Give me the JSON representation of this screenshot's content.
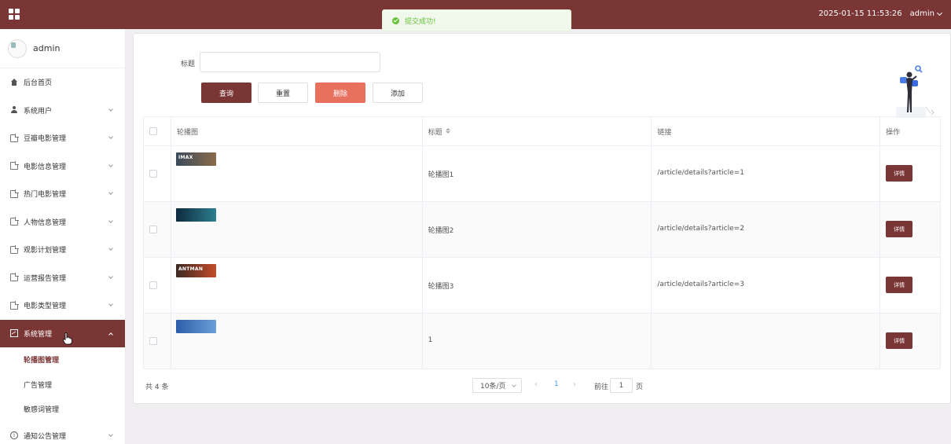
{
  "header": {
    "datetime": "2025-01-15 11:53:26",
    "user": "admin",
    "bar_color": "#7a3535"
  },
  "toast": {
    "message": "提交成功!",
    "type": "success"
  },
  "sidebar": {
    "user_name": "admin",
    "items": [
      {
        "label": "后台首页",
        "icon": "home-icon",
        "has_arrow": false
      },
      {
        "label": "系统用户",
        "icon": "user-icon",
        "has_arrow": true
      },
      {
        "label": "豆瓣电影管理",
        "icon": "document-icon",
        "has_arrow": true
      },
      {
        "label": "电影信息管理",
        "icon": "document-icon",
        "has_arrow": true
      },
      {
        "label": "热门电影管理",
        "icon": "document-icon",
        "has_arrow": true
      },
      {
        "label": "人物信息管理",
        "icon": "document-icon",
        "has_arrow": true
      },
      {
        "label": "观影计划管理",
        "icon": "document-icon",
        "has_arrow": true
      },
      {
        "label": "运营报告管理",
        "icon": "document-icon",
        "has_arrow": true
      },
      {
        "label": "电影类型管理",
        "icon": "document-icon",
        "has_arrow": true
      },
      {
        "label": "系统管理",
        "icon": "picture-icon",
        "has_arrow": true,
        "active": true
      }
    ],
    "sub_items": [
      {
        "label": "轮播图管理",
        "current": true
      },
      {
        "label": "广告管理"
      },
      {
        "label": "敏感词管理"
      }
    ],
    "last_item": {
      "label": "通知公告管理",
      "icon": "info-icon"
    }
  },
  "filter": {
    "title_label": "标题",
    "title_value": "",
    "buttons": {
      "query": "查询",
      "reset": "重置",
      "delete": "删除",
      "add": "添加"
    }
  },
  "table": {
    "headers": {
      "image": "轮播图",
      "title": "标题",
      "link": "链接",
      "action": "操作"
    },
    "rows": [
      {
        "thumb_label": "IMAX",
        "thumb_colors": [
          "#3a4a5a",
          "#8a6a4a"
        ],
        "title": "轮播图1",
        "link": "/article/details?article=1",
        "action": "详情"
      },
      {
        "thumb_label": "",
        "thumb_colors": [
          "#0e2a3e",
          "#2c7f8f"
        ],
        "title": "轮播图2",
        "link": "/article/details?article=2",
        "action": "详情"
      },
      {
        "thumb_label": "ANTMAN",
        "thumb_colors": [
          "#3b2a22",
          "#c44a2a"
        ],
        "title": "轮播图3",
        "link": "/article/details?article=3",
        "action": "详情"
      },
      {
        "thumb_label": "",
        "thumb_colors": [
          "#2a5ea8",
          "#6a9fd8"
        ],
        "title": "1",
        "link": "",
        "action": "详情"
      }
    ]
  },
  "pagination": {
    "total_text": "共 4 条",
    "page_size": "10条/页",
    "current_page": "1",
    "goto_label": "前往",
    "goto_value": "1",
    "goto_unit": "页"
  }
}
